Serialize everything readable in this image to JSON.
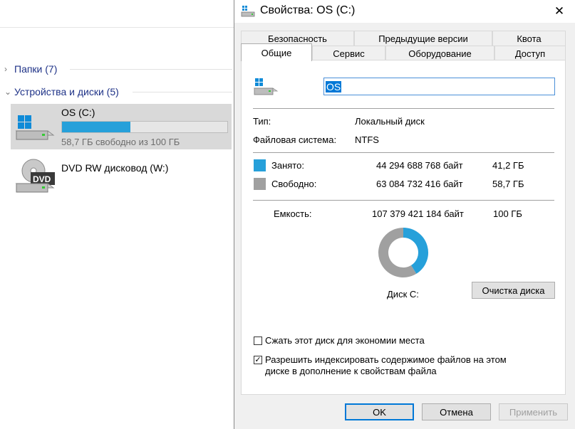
{
  "explorer": {
    "folders_header": "Папки (7)",
    "devices_header": "Устройства и диски (5)",
    "drives": [
      {
        "name": "OS (C:)",
        "free_text": "58,7 ГБ свободно из 100 ГБ",
        "used_fraction": 0.412
      },
      {
        "name": "DVD RW дисковод (W:)",
        "icon_label": "DVD"
      }
    ]
  },
  "dialog": {
    "title": "Свойства: OS (C:)",
    "close_glyph": "✕",
    "tabs_back": [
      "Безопасность",
      "Предыдущие версии",
      "Квота"
    ],
    "tabs_front": [
      "Общие",
      "Сервис",
      "Оборудование",
      "Доступ"
    ],
    "name_value": "OS",
    "type_label": "Тип:",
    "type_value": "Локальный диск",
    "fs_label": "Файловая система:",
    "fs_value": "NTFS",
    "used_label": "Занято:",
    "used_bytes": "44 294 688 768 байт",
    "used_size": "41,2 ГБ",
    "free_label": "Свободно:",
    "free_bytes": "63 084 732 416 байт",
    "free_size": "58,7 ГБ",
    "capacity_label": "Емкость:",
    "capacity_bytes": "107 379 421 184 байт",
    "capacity_size": "100 ГБ",
    "disk_label": "Диск C:",
    "cleanup_button": "Очистка диска",
    "compress_label": "Сжать этот диск для экономии места",
    "compress_checked": false,
    "index_label_1": "Разрешить индексировать содержимое файлов на этом",
    "index_label_2": "диске в дополнение к свойствам файла",
    "index_checked": true,
    "ok_button": "OK",
    "cancel_button": "Отмена",
    "apply_button": "Применить",
    "colors": {
      "used": "#26a0da",
      "free": "#a0a0a0",
      "accent": "#0078d7"
    },
    "used_fraction": 0.412
  }
}
